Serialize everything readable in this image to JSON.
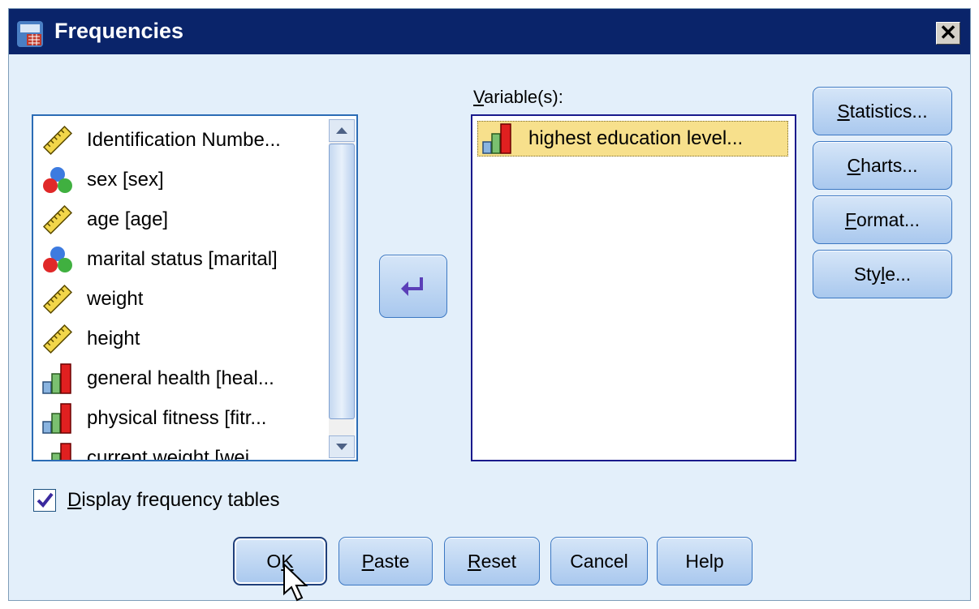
{
  "window": {
    "title": "Frequencies",
    "close_glyph": "✕"
  },
  "source_list": {
    "items": [
      {
        "label": "Identification Numbe...",
        "icon": "ruler-scale-icon"
      },
      {
        "label": "sex [sex]",
        "icon": "nominal-balls-icon"
      },
      {
        "label": "age [age]",
        "icon": "ruler-scale-icon"
      },
      {
        "label": "marital status [marital]",
        "icon": "nominal-balls-icon"
      },
      {
        "label": "weight",
        "icon": "ruler-scale-icon"
      },
      {
        "label": "height",
        "icon": "ruler-scale-icon"
      },
      {
        "label": "general health [heal...",
        "icon": "ordinal-bars-icon"
      },
      {
        "label": "physical fitness [fitr...",
        "icon": "ordinal-bars-icon"
      },
      {
        "label": "current weight [wei...",
        "icon": "ordinal-bars-icon"
      }
    ]
  },
  "target": {
    "label_prefix": "V",
    "label_rest": "ariable(s):",
    "items": [
      {
        "label": "highest education level...",
        "icon": "ordinal-bars-icon"
      }
    ]
  },
  "side_buttons": [
    {
      "u": "S",
      "rest": "tatistics..."
    },
    {
      "u": "C",
      "rest": "harts..."
    },
    {
      "u": "F",
      "rest": "ormat..."
    },
    {
      "pre": "Sty",
      "u": "l",
      "rest": "e..."
    }
  ],
  "checkbox": {
    "u": "D",
    "rest": "isplay frequency tables",
    "checked": true
  },
  "bottom_buttons": [
    {
      "pre": "O",
      "u": "K",
      "rest": ""
    },
    {
      "u": "P",
      "rest": "aste"
    },
    {
      "u": "R",
      "rest": "eset"
    },
    {
      "label": "Cancel"
    },
    {
      "label": "Help"
    }
  ],
  "colors": {
    "titlebar": "#0a246a",
    "dialog_bg": "#e3effa",
    "selection": "#f7e08c"
  }
}
